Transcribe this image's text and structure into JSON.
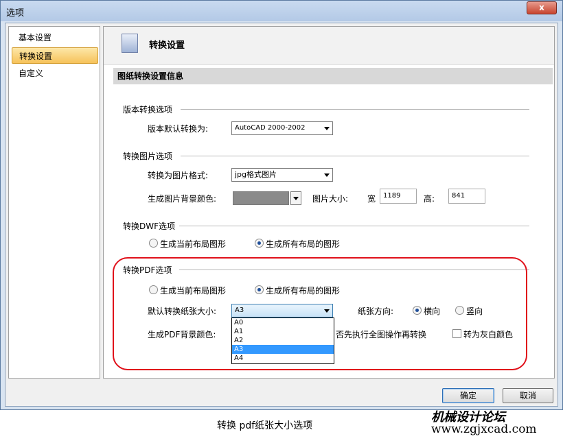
{
  "window": {
    "title": "选项",
    "close_label": "x"
  },
  "sidebar": {
    "items": [
      {
        "label": "基本设置",
        "selected": false
      },
      {
        "label": "转换设置",
        "selected": true
      },
      {
        "label": "自定义",
        "selected": false
      }
    ]
  },
  "panel": {
    "header_title": "转换设置",
    "section_title": "图纸转换设置信息",
    "version_group": {
      "title": "版本转换选项",
      "default_label": "版本默认转换为:",
      "default_value": "AutoCAD 2000-2002"
    },
    "image_group": {
      "title": "转换图片选项",
      "format_label": "转换为图片格式:",
      "format_value": "jpg格式图片",
      "bg_label": "生成图片背景颜色:",
      "bg_color": "#8a8a8a",
      "size_label": "图片大小:",
      "width_label": "宽",
      "width_value": "1189",
      "height_label": "高:",
      "height_value": "841"
    },
    "dwf_group": {
      "title": "转换DWF选项",
      "opt_current": "生成当前布局图形",
      "opt_all": "生成所有布局的图形",
      "selected": "all"
    },
    "pdf_group": {
      "title": "转换PDF选项",
      "opt_current": "生成当前布局图形",
      "opt_all": "生成所有布局的图形",
      "selected": "all",
      "paper_label": "默认转换纸张大小:",
      "paper_value": "A3",
      "paper_options": [
        "A0",
        "A1",
        "A2",
        "A3",
        "A4"
      ],
      "orient_label": "纸张方向:",
      "orient_landscape": "横向",
      "orient_portrait": "竖向",
      "orient_selected": "landscape",
      "bg_label": "生成PDF背景颜色:",
      "full_op_label": "否先执行全图操作再转换",
      "gray_label": "转为灰白颜色"
    }
  },
  "buttons": {
    "ok": "确定",
    "cancel": "取消"
  },
  "caption": "转换 pdf纸张大小选项",
  "watermark": {
    "line1": "机械设计论坛",
    "line2": "www.zgjxcad.com"
  },
  "colors": {
    "highlight_red": "#e0101a",
    "selection_blue": "#3399ff"
  }
}
